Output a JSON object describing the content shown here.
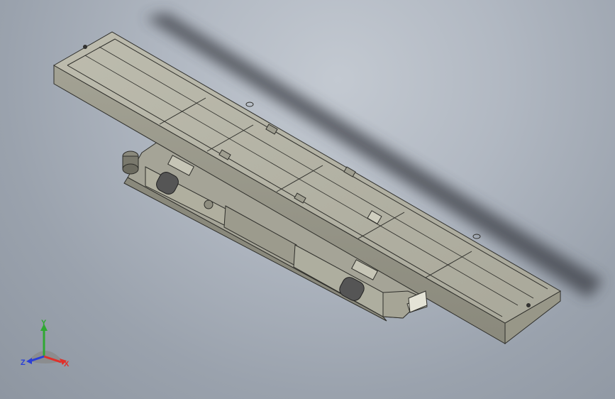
{
  "viewport": {
    "name": "3D model view",
    "colors": {
      "background_center": "#c3c9d1",
      "background_edge": "#8e96a1",
      "model_face": "#b5b4a6",
      "model_face_dark": "#8f8e80",
      "model_edge": "#2e2e2a",
      "shadow": "#3a3e45"
    }
  },
  "triad": {
    "x_label": "X",
    "y_label": "Y",
    "z_label": "Z",
    "colors": {
      "x": "#e0302a",
      "y": "#2fa832",
      "z": "#2b3fd6"
    }
  }
}
